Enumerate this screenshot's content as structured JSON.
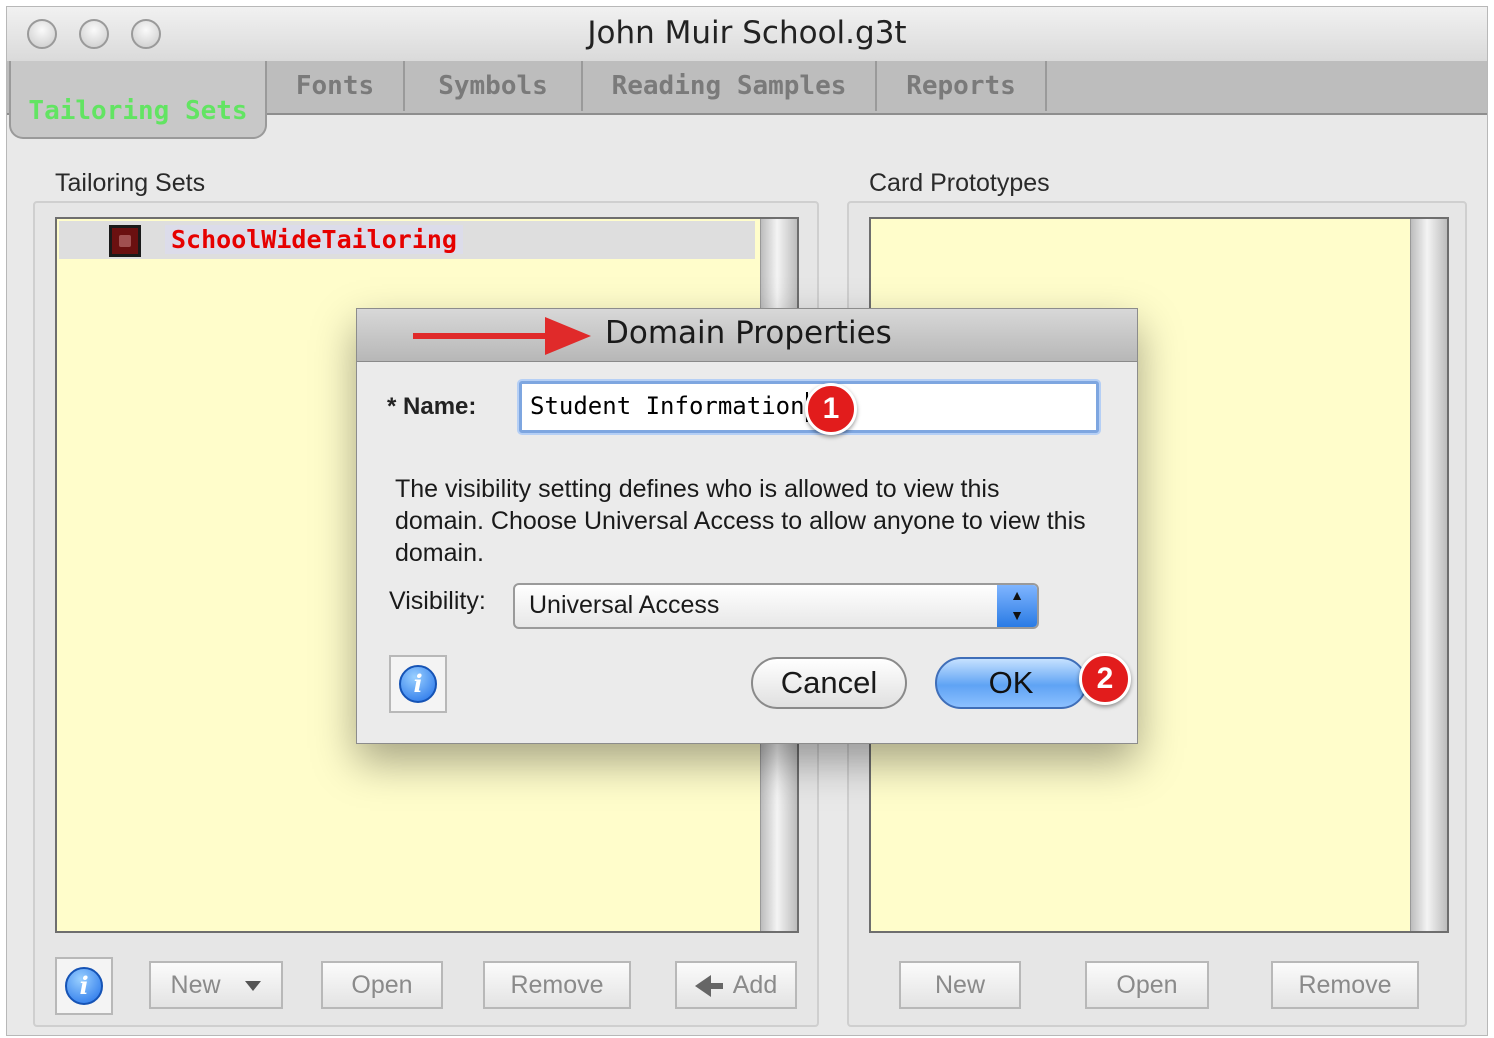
{
  "window": {
    "title": "John Muir School.g3t"
  },
  "tabs": [
    {
      "label": "Tailoring Sets",
      "active": true
    },
    {
      "label": "Fonts",
      "active": false
    },
    {
      "label": "Symbols",
      "active": false
    },
    {
      "label": "Reading Samples",
      "active": false
    },
    {
      "label": "Reports",
      "active": false
    }
  ],
  "left_panel": {
    "title": "Tailoring Sets",
    "items": [
      {
        "label": "SchoolWideTailoring",
        "color": "#e60000"
      }
    ],
    "buttons": {
      "new": "New",
      "open": "Open",
      "remove": "Remove",
      "add": "Add"
    }
  },
  "right_panel": {
    "title": "Card Prototypes",
    "buttons": {
      "new": "New",
      "open": "Open",
      "remove": "Remove"
    }
  },
  "dialog": {
    "title": "Domain Properties",
    "name_label": "* Name:",
    "name_value": "Student Information",
    "description": "The visibility setting defines who is allowed to view this domain. Choose Universal Access to allow anyone to view this domain.",
    "visibility_label": "Visibility:",
    "visibility_value": "Universal Access",
    "cancel_label": "Cancel",
    "ok_label": "OK",
    "info_glyph": "i"
  },
  "annotations": {
    "badge1": "1",
    "badge2": "2",
    "arrow_color": "#e02a2a"
  },
  "icons": {
    "info": "info-icon",
    "add_arrow": "arrow-left-icon",
    "dropdown": "chevron-down-icon"
  }
}
